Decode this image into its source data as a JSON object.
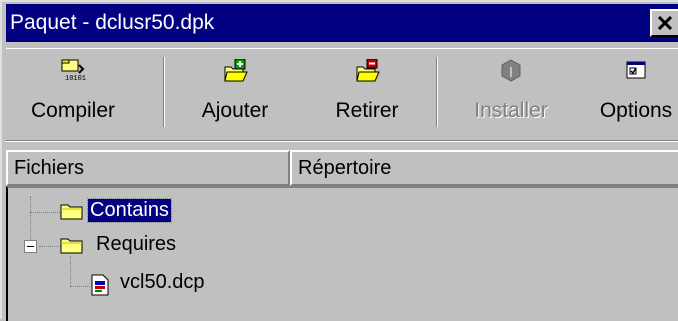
{
  "window": {
    "title": "Paquet - dclusr50.dpk",
    "close_label": "×"
  },
  "toolbar": {
    "buttons": [
      {
        "label": "Compiler",
        "icon": "compile-icon",
        "enabled": true
      },
      {
        "label": "Ajouter",
        "icon": "add-icon",
        "enabled": true
      },
      {
        "label": "Retirer",
        "icon": "remove-icon",
        "enabled": true
      },
      {
        "label": "Installer",
        "icon": "install-icon",
        "enabled": false
      },
      {
        "label": "Options",
        "icon": "options-icon",
        "enabled": true
      }
    ]
  },
  "columns": [
    {
      "label": "Fichiers"
    },
    {
      "label": "Répertoire"
    }
  ],
  "tree": [
    {
      "label": "Contains",
      "icon": "folder-icon",
      "selected": true
    },
    {
      "label": "Requires",
      "icon": "folder-icon",
      "selected": false,
      "expanded": true
    },
    {
      "label": "vcl50.dcp",
      "icon": "package-file-icon",
      "selected": false
    }
  ],
  "colors": {
    "title_bar": "#000080",
    "face": "#c0c0c0",
    "selection": "#000080"
  }
}
